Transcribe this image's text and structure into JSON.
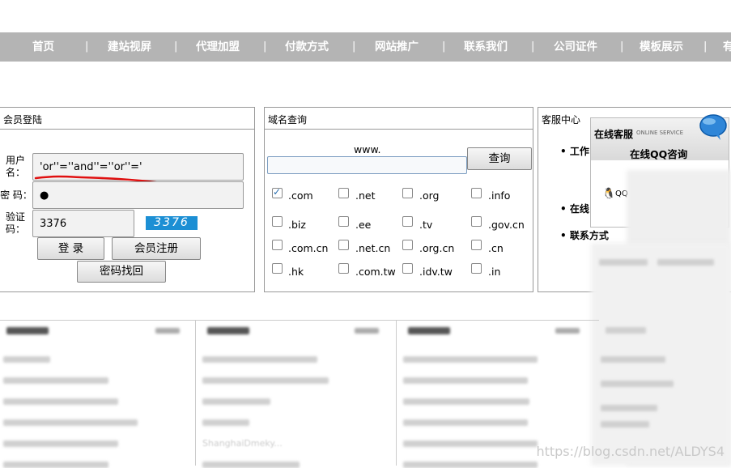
{
  "nav": {
    "items": [
      "首页",
      "建站视屏",
      "代理加盟",
      "付款方式",
      "网站推广",
      "联系我们",
      "公司证件",
      "模板展示",
      "有"
    ],
    "separator": "|"
  },
  "login": {
    "title": "会员登陆",
    "username_label": "用户名：",
    "username_value": "'or''=''and''=''or''='",
    "password_label": "密 码：",
    "password_value": "●",
    "captcha_label": "验证码：",
    "captcha_value": "3376",
    "captcha_image_text": "3376",
    "login_button": "登 录",
    "register_button": "会员注册",
    "recover_button": "密码找回"
  },
  "domain": {
    "title": "域名查询",
    "www_label": "www.",
    "input_value": "",
    "query_button": "查询",
    "tlds": [
      {
        "label": ".com",
        "checked": true
      },
      {
        "label": ".net",
        "checked": false
      },
      {
        "label": ".org",
        "checked": false
      },
      {
        "label": ".info",
        "checked": false
      },
      {
        "label": ".biz",
        "checked": false
      },
      {
        "label": ".ee",
        "checked": false
      },
      {
        "label": ".tv",
        "checked": false
      },
      {
        "label": ".gov.cn",
        "checked": false
      },
      {
        "label": ".com.cn",
        "checked": false
      },
      {
        "label": ".net.cn",
        "checked": false
      },
      {
        "label": ".org.cn",
        "checked": false
      },
      {
        "label": ".cn",
        "checked": false
      },
      {
        "label": ".hk",
        "checked": false
      },
      {
        "label": ".com.tw",
        "checked": false
      },
      {
        "label": ".idv.tw",
        "checked": false
      },
      {
        "label": ".in",
        "checked": false
      }
    ]
  },
  "service": {
    "title": "客服中心",
    "items": [
      "工作",
      "在线",
      "联系方式"
    ],
    "float_title": "在线客服",
    "float_subtitle": "ONLINE SERVICE",
    "float_heading": "在线QQ咨询",
    "qq_label": "QQ"
  },
  "bottom": {
    "col2_visible_text": "ShanghaiDmeky..."
  },
  "watermark": "https://blog.csdn.net/ALDYS4",
  "colors": {
    "navbar": "#b4b4b4",
    "captcha_bg": "#1c8fd4",
    "annotation_red": "#e01010"
  }
}
